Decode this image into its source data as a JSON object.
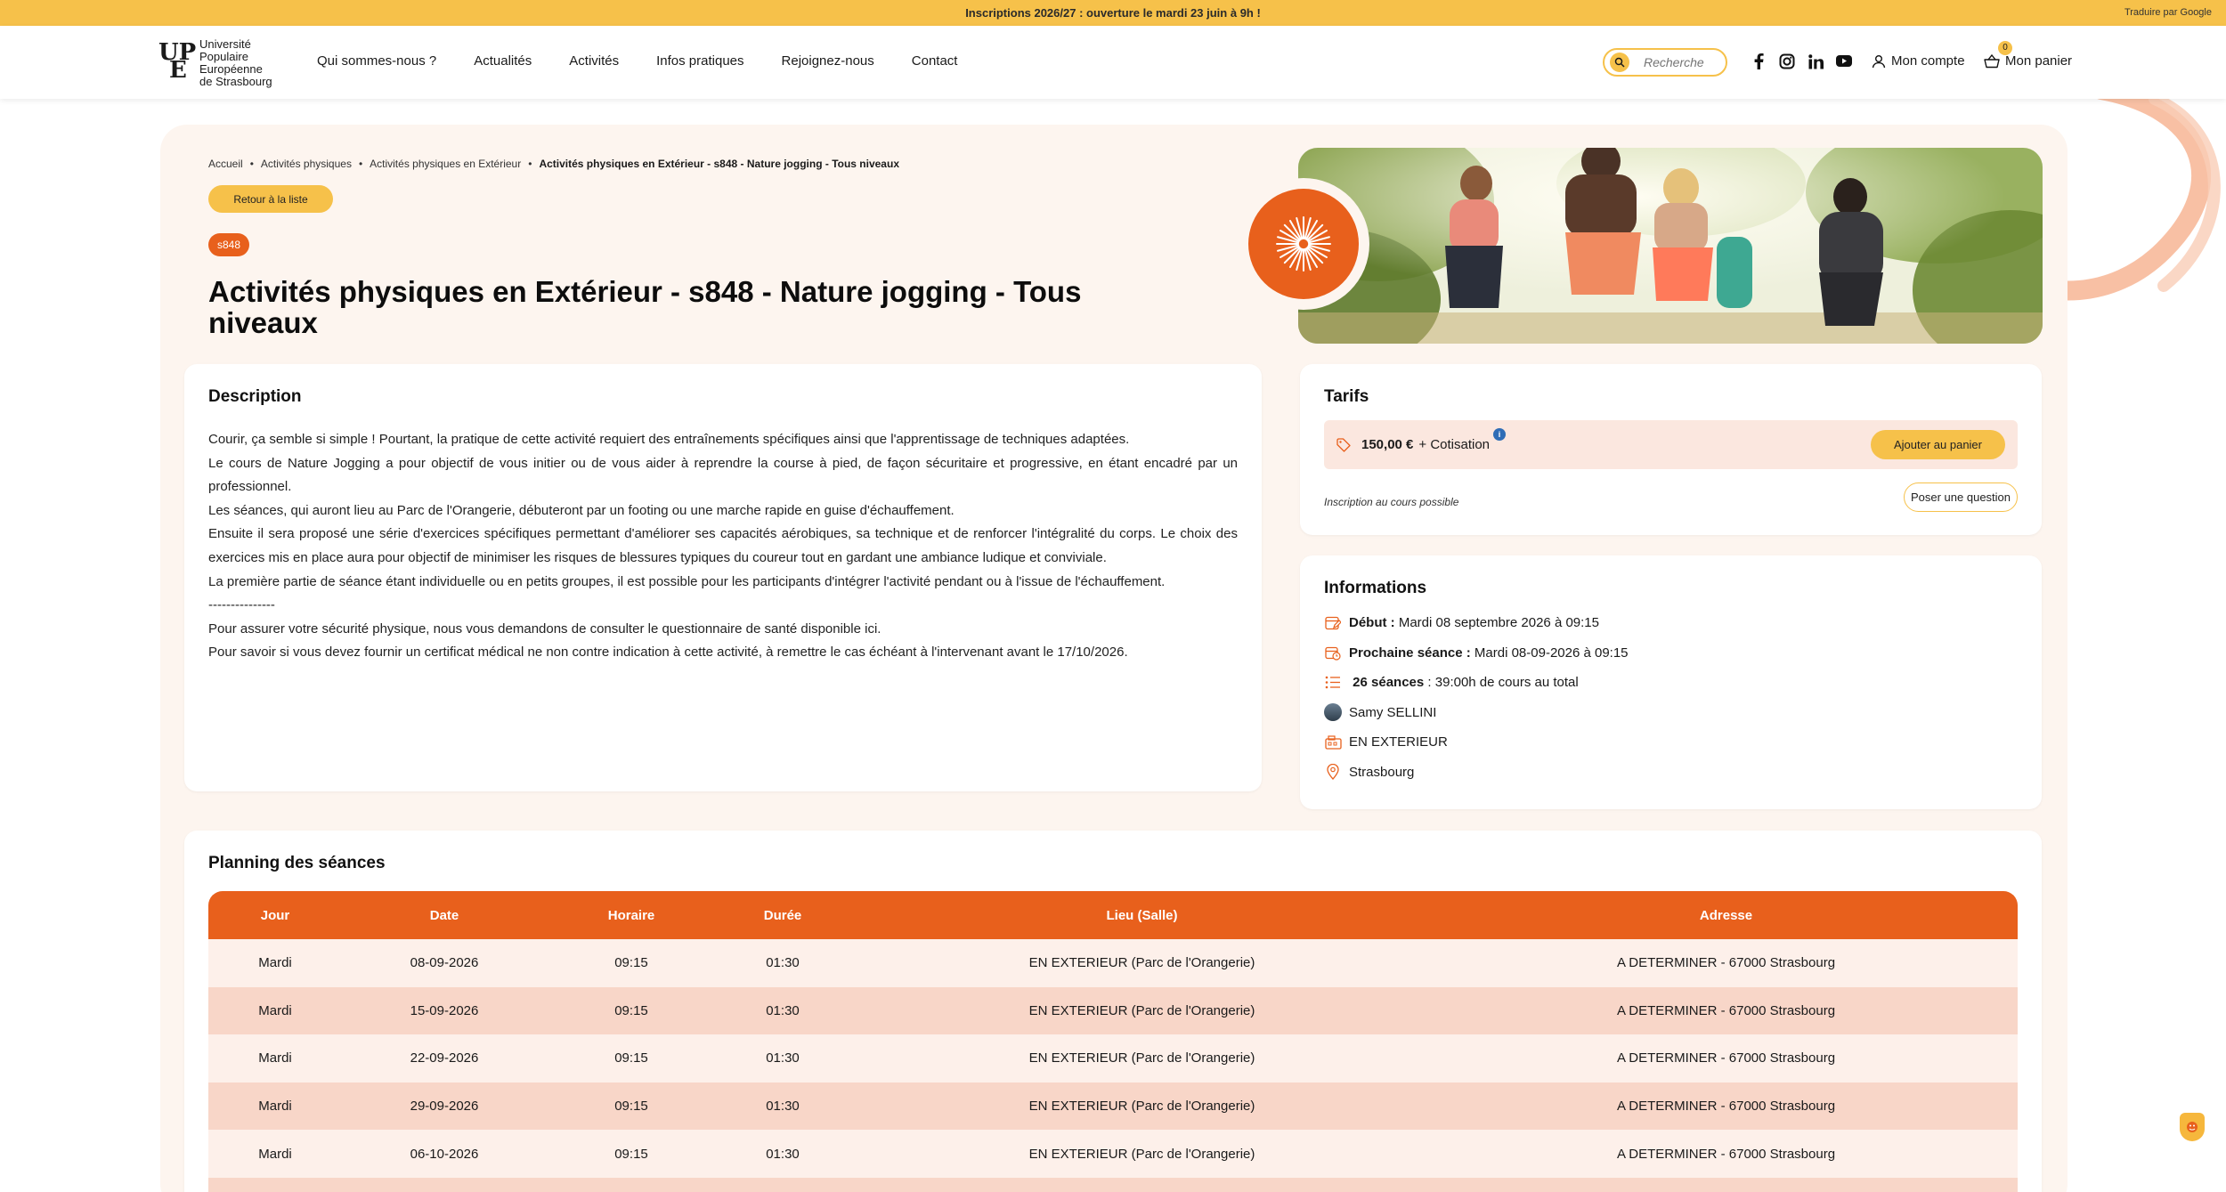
{
  "topbar": {
    "announcement": "Inscriptions 2026/27 : ouverture le mardi 23 juin à 9h !",
    "translate": "Traduire par Google"
  },
  "header": {
    "logo_lines": [
      "Université",
      "Populaire",
      "Européenne",
      "de Strasbourg"
    ],
    "logo_mark_top": "UP",
    "logo_mark_bottom": "E",
    "nav": [
      "Qui sommes-nous ?",
      "Actualités",
      "Activités",
      "Infos pratiques",
      "Rejoignez-nous",
      "Contact"
    ],
    "search_placeholder": "Recherche",
    "account_label": "Mon compte",
    "cart_label": "Mon panier",
    "cart_count": "0",
    "socials": [
      "facebook-icon",
      "instagram-icon",
      "linkedin-icon",
      "youtube-icon"
    ]
  },
  "breadcrumb": [
    "Accueil",
    "Activités physiques",
    "Activités physiques en Extérieur",
    "Activités physiques en Extérieur - s848 - Nature jogging - Tous niveaux"
  ],
  "back_button": "Retour à la liste",
  "code": "s848",
  "title": "Activités physiques en Extérieur - s848 - Nature jogging - Tous niveaux",
  "description": {
    "heading": "Description",
    "paragraphs": [
      "Courir, ça semble si simple ! Pourtant, la pratique de cette activité requiert des entraînements spécifiques ainsi que l'apprentissage de techniques adaptées.",
      "Le cours de Nature Jogging a pour objectif de vous initier ou de vous aider à reprendre la course à pied, de façon sécuritaire et progressive, en étant encadré par un professionnel.",
      "Les séances, qui auront lieu au Parc de l'Orangerie, débuteront par un footing ou une marche rapide en guise d'échauffement.",
      "Ensuite il sera proposé une série d'exercices spécifiques permettant d'améliorer ses capacités aérobiques, sa technique et de renforcer l'intégralité du corps. Le choix des exercices mis en place aura pour objectif de minimiser les risques de blessures typiques du coureur tout en gardant une ambiance ludique et conviviale.",
      "La première partie de séance étant individuelle ou en petits groupes, il est possible pour les participants d'intégrer l'activité pendant ou à l'issue de l'échauffement.",
      "---------------",
      "Pour assurer votre sécurité physique, nous vous demandons de consulter le questionnaire de santé disponible ici.",
      "Pour savoir si vous devez fournir un certificat médical ne non contre indication à cette activité, à remettre le cas échéant à l'intervenant avant le 17/10/2026."
    ]
  },
  "tarifs": {
    "heading": "Tarifs",
    "amount": "150,00 €",
    "suffix": "+ Cotisation",
    "info_mark": "i",
    "add_button": "Ajouter au panier",
    "note": "Inscription au cours possible",
    "question_button": "Poser une question"
  },
  "informations": {
    "heading": "Informations",
    "debut_label": "Début :",
    "debut_value": "Mardi 08 septembre 2026 à 09:15",
    "next_label": "Prochaine séance :",
    "next_value": "Mardi 08-09-2026 à 09:15",
    "sessions_label": "26 séances",
    "sessions_value": ": 39:00h de cours au total",
    "teacher": "Samy SELLINI",
    "place": "EN EXTERIEUR",
    "city": "Strasbourg"
  },
  "planning": {
    "heading": "Planning des séances",
    "columns": [
      "Jour",
      "Date",
      "Horaire",
      "Durée",
      "Lieu (Salle)",
      "Adresse"
    ],
    "rows": [
      [
        "Mardi",
        "08-09-2026",
        "09:15",
        "01:30",
        "EN EXTERIEUR (Parc de l'Orangerie)",
        "A DETERMINER - 67000 Strasbourg"
      ],
      [
        "Mardi",
        "15-09-2026",
        "09:15",
        "01:30",
        "EN EXTERIEUR (Parc de l'Orangerie)",
        "A DETERMINER - 67000 Strasbourg"
      ],
      [
        "Mardi",
        "22-09-2026",
        "09:15",
        "01:30",
        "EN EXTERIEUR (Parc de l'Orangerie)",
        "A DETERMINER - 67000 Strasbourg"
      ],
      [
        "Mardi",
        "29-09-2026",
        "09:15",
        "01:30",
        "EN EXTERIEUR (Parc de l'Orangerie)",
        "A DETERMINER - 67000 Strasbourg"
      ],
      [
        "Mardi",
        "06-10-2026",
        "09:15",
        "01:30",
        "EN EXTERIEUR (Parc de l'Orangerie)",
        "A DETERMINER - 67000 Strasbourg"
      ],
      [
        "",
        "",
        "",
        "",
        "",
        ""
      ]
    ]
  },
  "colors": {
    "accent_yellow": "#f6c14a",
    "accent_orange": "#e8601c",
    "background_cream": "#fdf5ef"
  }
}
